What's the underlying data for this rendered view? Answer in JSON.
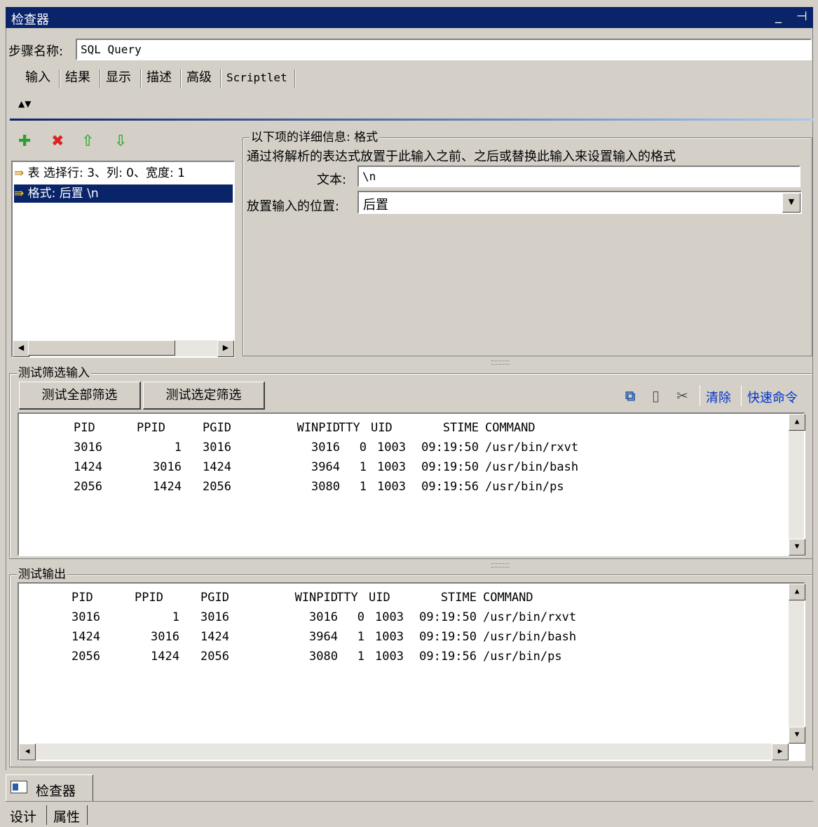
{
  "window": {
    "title": "检查器",
    "minimize": "_",
    "pin": "ᐩ"
  },
  "step": {
    "label": "步骤名称:",
    "value": "SQL Query"
  },
  "tabs": [
    "输入",
    "结果",
    "显示",
    "描述",
    "高级",
    "Scriptlet"
  ],
  "sort_arrows": "▲▼",
  "toolbar_icons": [
    "add-icon",
    "delete-icon",
    "move-up-icon",
    "move-down-icon"
  ],
  "input_list": {
    "items": [
      {
        "text": "表 选择行: 3、列: 0、宽度: 1",
        "selected": false
      },
      {
        "text": "格式: 后置 \\n",
        "selected": true
      }
    ]
  },
  "detail": {
    "legend": "以下项的详细信息: 格式",
    "description": "通过将解析的表达式放置于此输入之前、之后或替换此输入来设置输入的格式",
    "text_label": "文本:",
    "text_value": "\\n",
    "position_label": "放置输入的位置:",
    "position_value": "后置"
  },
  "test_input": {
    "legend": "测试筛选输入",
    "btn_all": "测试全部筛选",
    "btn_selected": "测试选定筛选",
    "clear": "清除",
    "quick_cmd": "快速命令"
  },
  "test_output": {
    "legend": "测试输出"
  },
  "table": {
    "headers": [
      "PID",
      "PPID",
      "PGID",
      "WINPID",
      "TTY",
      "UID",
      "STIME",
      "COMMAND"
    ],
    "rows": [
      [
        "3016",
        "1",
        "3016",
        "3016",
        "0",
        "1003",
        "09:19:50",
        "/usr/bin/rxvt"
      ],
      [
        "1424",
        "3016",
        "1424",
        "3964",
        "1",
        "1003",
        "09:19:50",
        "/usr/bin/bash"
      ],
      [
        "2056",
        "1424",
        "2056",
        "3080",
        "1",
        "1003",
        "09:19:56",
        "/usr/bin/ps"
      ]
    ]
  },
  "bottom": {
    "panel_tab": "检查器",
    "tabs": [
      "设计",
      "属性"
    ]
  },
  "colors": {
    "title_bg": "#0a246a",
    "selection": "#0a246a",
    "panel": "#d4d0c8",
    "link": "#0033cc"
  }
}
